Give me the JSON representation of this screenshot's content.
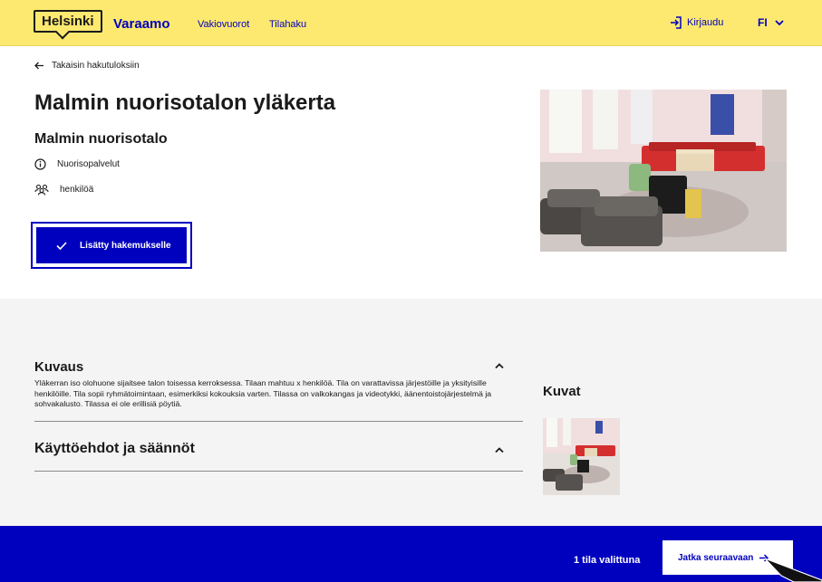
{
  "header": {
    "logo": "Helsinki",
    "app_name": "Varaamo",
    "nav": [
      "Vakiovuorot",
      "Tilahaku"
    ],
    "login_label": "Kirjaudu",
    "language": "FI"
  },
  "back_link": "Takaisin hakutuloksiin",
  "space": {
    "title": "Malmin nuorisotalon yläkerta",
    "unit": "Malmin nuorisotalo",
    "service": "Nuorisopalvelut",
    "capacity": "henkilöä",
    "added_button": "Lisätty hakemukselle"
  },
  "description": {
    "title": "Kuvaus",
    "text": "Yläkerran iso olohuone sijaitsee talon toisessa kerroksessa. Tilaan mahtuu x henkilöä. Tila on varattavissa järjestöille ja yksityisille henkilöille. Tila sopii ryhmätoimintaan, esimerkiksi kokouksia varten. Tilassa on valkokangas ja videotykki, äänentoistojärjestelmä ja sohvakalusto. Tilassa ei ole erillisiä pöytiä."
  },
  "terms": {
    "title": "Käyttöehdot ja säännöt"
  },
  "images": {
    "title": "Kuvat"
  },
  "footer": {
    "selected_text": "1 tila valittuna",
    "next_button": "Jatka seuraavaan"
  },
  "colors": {
    "header_bg": "#fde96f",
    "brand_blue": "#0000bf",
    "grey_bg": "#f4f4f4"
  }
}
